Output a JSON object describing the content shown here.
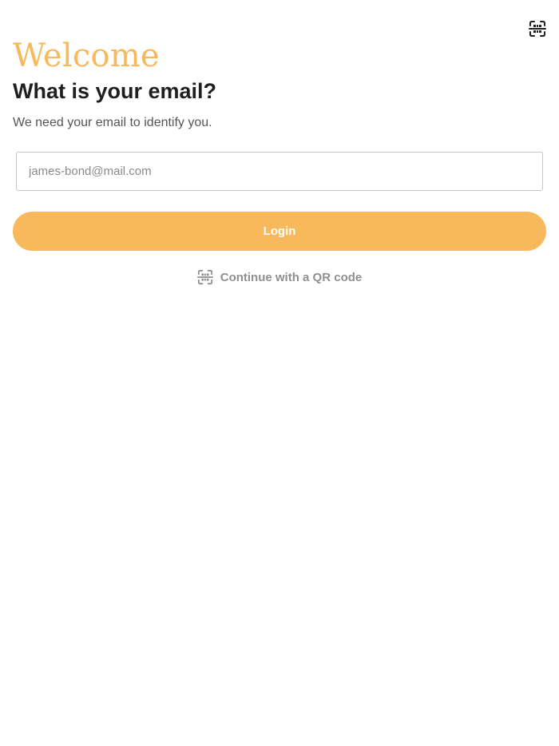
{
  "header": {
    "qr_icon": "qr-scan-icon"
  },
  "intro": {
    "welcome": "Welcome",
    "question": "What is your email?",
    "description": "We need your email to identify you."
  },
  "form": {
    "email_placeholder": "james-bond@mail.com",
    "email_value": "",
    "login_label": "Login"
  },
  "qr_option": {
    "icon": "qr-scan-icon",
    "label": "Continue with a QR code"
  },
  "colors": {
    "accent": "#f8b95c",
    "heading": "#1f1f1f",
    "muted": "#8f8f8f"
  }
}
